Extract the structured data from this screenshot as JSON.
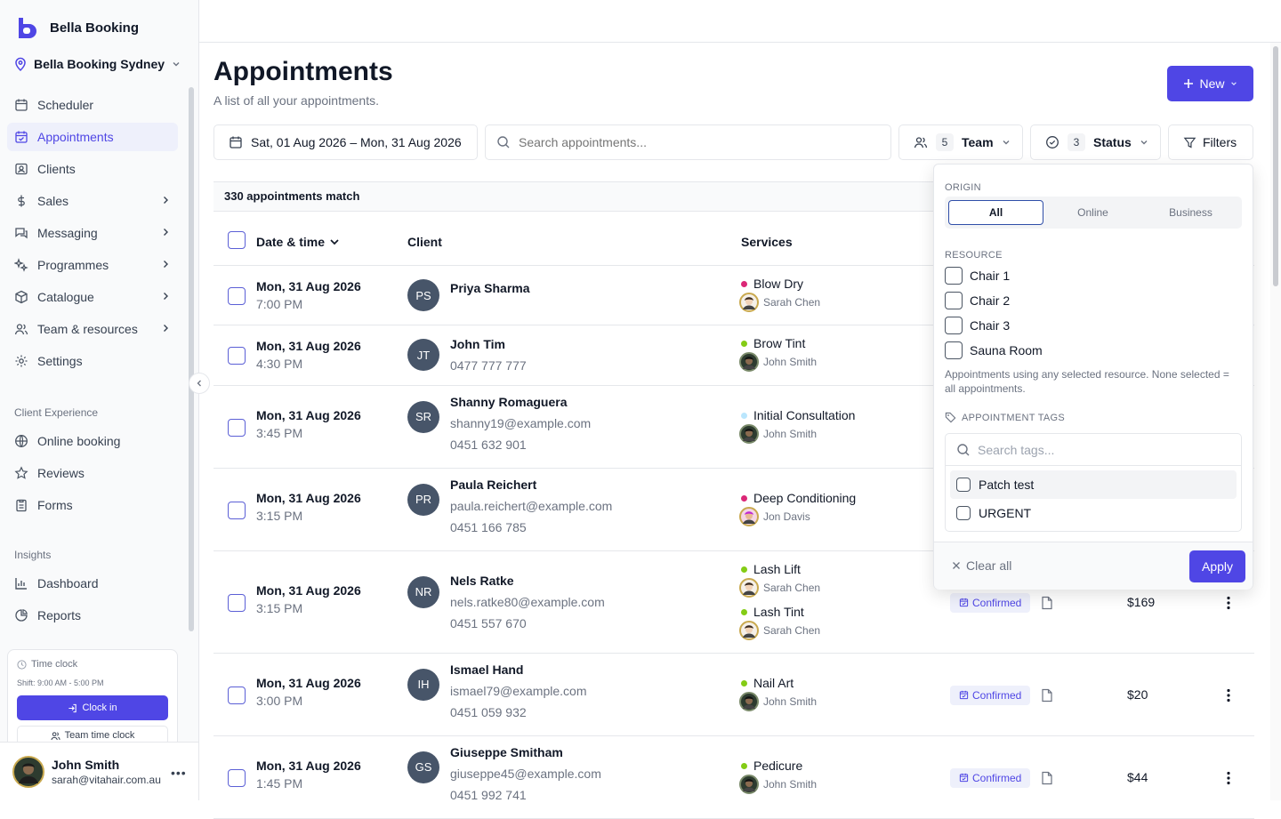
{
  "brand": {
    "name": "Bella Booking"
  },
  "location": {
    "name": "Bella Booking Sydney"
  },
  "nav": {
    "scheduler": "Scheduler",
    "appointments": "Appointments",
    "clients": "Clients",
    "sales": "Sales",
    "messaging": "Messaging",
    "programmes": "Programmes",
    "catalogue": "Catalogue",
    "team": "Team & resources",
    "settings": "Settings"
  },
  "client_experience": {
    "label": "Client Experience",
    "online_booking": "Online booking",
    "reviews": "Reviews",
    "forms": "Forms"
  },
  "insights": {
    "label": "Insights",
    "dashboard": "Dashboard",
    "reports": "Reports"
  },
  "time_clock": {
    "title": "Time clock",
    "shift": "Shift: 9:00 AM - 5:00 PM",
    "clock_in": "Clock in",
    "team_clock": "Team time clock"
  },
  "user": {
    "name": "John Smith",
    "email": "sarah@vitahair.com.au",
    "more": "•••"
  },
  "page": {
    "title": "Appointments",
    "subtitle": "A list of all your appointments.",
    "new_label": "New"
  },
  "toolbar": {
    "date_range": "Sat, 01 Aug 2026 – Mon, 31 Aug 2026",
    "search_placeholder": "Search appointments...",
    "team_count": "5",
    "team_label": "Team",
    "status_count": "3",
    "status_label": "Status",
    "filters_label": "Filters"
  },
  "match_text": "330 appointments match",
  "columns": {
    "datetime": "Date & time",
    "client": "Client",
    "services": "Services"
  },
  "rows": [
    {
      "date": "Mon, 31 Aug 2026",
      "time": "7:00 PM",
      "initials": "PS",
      "name": "Priya Sharma",
      "email": "",
      "phone": "",
      "services": [
        {
          "name": "Blow Dry",
          "staff": "Sarah Chen"
        }
      ],
      "status": "",
      "price": ""
    },
    {
      "date": "Mon, 31 Aug 2026",
      "time": "4:30 PM",
      "initials": "JT",
      "name": "John Tim",
      "email": "0477 777 777",
      "phone": "",
      "services": [
        {
          "name": "Brow Tint",
          "staff": "John Smith"
        }
      ],
      "status": "",
      "price": ""
    },
    {
      "date": "Mon, 31 Aug 2026",
      "time": "3:45 PM",
      "initials": "SR",
      "name": "Shanny Romaguera",
      "email": "shanny19@example.com",
      "phone": "0451 632 901",
      "services": [
        {
          "name": "Initial Consultation",
          "staff": "John Smith"
        }
      ],
      "status": "",
      "price": ""
    },
    {
      "date": "Mon, 31 Aug 2026",
      "time": "3:15 PM",
      "initials": "PR",
      "name": "Paula Reichert",
      "email": "paula.reichert@example.com",
      "phone": "0451 166 785",
      "services": [
        {
          "name": "Deep Conditioning",
          "staff": "Jon Davis"
        }
      ],
      "status": "",
      "price": ""
    },
    {
      "date": "Mon, 31 Aug 2026",
      "time": "3:15 PM",
      "initials": "NR",
      "name": "Nels Ratke",
      "email": "nels.ratke80@example.com",
      "phone": "0451 557 670",
      "services": [
        {
          "name": "Lash Lift",
          "staff": "Sarah Chen"
        },
        {
          "name": "Lash Tint",
          "staff": "Sarah Chen"
        }
      ],
      "status": "Confirmed",
      "price": "$169"
    },
    {
      "date": "Mon, 31 Aug 2026",
      "time": "3:00 PM",
      "initials": "IH",
      "name": "Ismael Hand",
      "email": "ismael79@example.com",
      "phone": "0451 059 932",
      "services": [
        {
          "name": "Nail Art",
          "staff": "John Smith"
        }
      ],
      "status": "Confirmed",
      "price": "$20"
    },
    {
      "date": "Mon, 31 Aug 2026",
      "time": "1:45 PM",
      "initials": "GS",
      "name": "Giuseppe Smitham",
      "email": "giuseppe45@example.com",
      "phone": "0451 992 741",
      "services": [
        {
          "name": "Pedicure",
          "staff": "John Smith"
        }
      ],
      "status": "Confirmed",
      "price": "$44"
    }
  ],
  "service_colors": {
    "Blow Dry": "#db2777",
    "Brow Tint": "#84cc16",
    "Initial Consultation": "#bae6fd",
    "Deep Conditioning": "#db2777",
    "Lash Lift": "#84cc16",
    "Lash Tint": "#84cc16",
    "Nail Art": "#84cc16",
    "Pedicure": "#84cc16"
  },
  "filters_panel": {
    "origin_label": "ORIGIN",
    "origin_options": [
      "All",
      "Online",
      "Business"
    ],
    "origin_selected": "All",
    "resource_label": "RESOURCE",
    "resources": [
      "Chair 1",
      "Chair 2",
      "Chair 3",
      "Sauna Room"
    ],
    "resource_hint": "Appointments using any selected resource. None selected = all appointments.",
    "tags_label": "APPOINTMENT TAGS",
    "tags_placeholder": "Search tags...",
    "tags": [
      "Patch test",
      "URGENT"
    ],
    "clear_label": "Clear all",
    "apply_label": "Apply"
  },
  "colors": {
    "accent": "#4f46e5",
    "badge_bg": "#eef0fb"
  }
}
